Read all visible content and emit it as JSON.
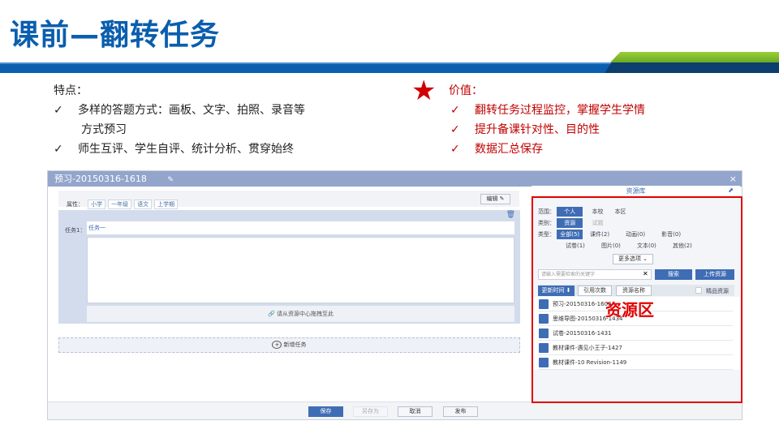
{
  "title": "课前—翻转任务",
  "features": {
    "heading": "特点：",
    "items": [
      "多样的答题方式：画板、文字、拍照、录音等",
      "方式预习",
      "师生互评、学生自评、统计分析、贯穿始终"
    ]
  },
  "values": {
    "heading": "价值：",
    "items": [
      "翻转任务过程监控，掌握学生学情",
      "提升备课针对性、目的性",
      "数据汇总保存"
    ]
  },
  "check": "✓",
  "dialog": {
    "title": "预习-20150316-1618",
    "close": "×",
    "attr_label": "属性：",
    "tags": [
      "小学",
      "一年级",
      "语文",
      "上学期"
    ],
    "edit": "编辑",
    "task_label": "任务1：",
    "task_value": "任务一",
    "drag_hint": "请从资源中心拖拽至此",
    "add_task": "新增任务",
    "footer": {
      "save": "保存",
      "save_as": "另存为",
      "cancel": "取消",
      "publish": "发布"
    }
  },
  "resource": {
    "title": "资源库",
    "scope_label": "范围：",
    "scopes": [
      "个人",
      "本校",
      "本区"
    ],
    "category_label": "类别：",
    "categories": [
      "资源",
      "试题"
    ],
    "type_label": "类型：",
    "types": [
      "全部(5)",
      "课件(2)",
      "动画(0)",
      "影音(0)",
      "试卷(1)",
      "图片(0)",
      "文本(0)",
      "其他(2)"
    ],
    "more": "更多选项",
    "search_placeholder": "请输入需要检索的关键字",
    "search": "搜索",
    "upload": "上传资源",
    "sorts": [
      "更新时间 ⬇",
      "引用次数",
      "资源名称"
    ],
    "premium": "精品资源",
    "items": [
      "预习-20150316-1603",
      "思维导图-20150316-1434",
      "试卷-20150316-1431",
      "教材课件-遇见小王子-1427",
      "教材课件-10 Revision-1149"
    ],
    "annotation": "资源区"
  },
  "colors": {
    "brand": "#0b5eae",
    "accent": "#c00000"
  }
}
